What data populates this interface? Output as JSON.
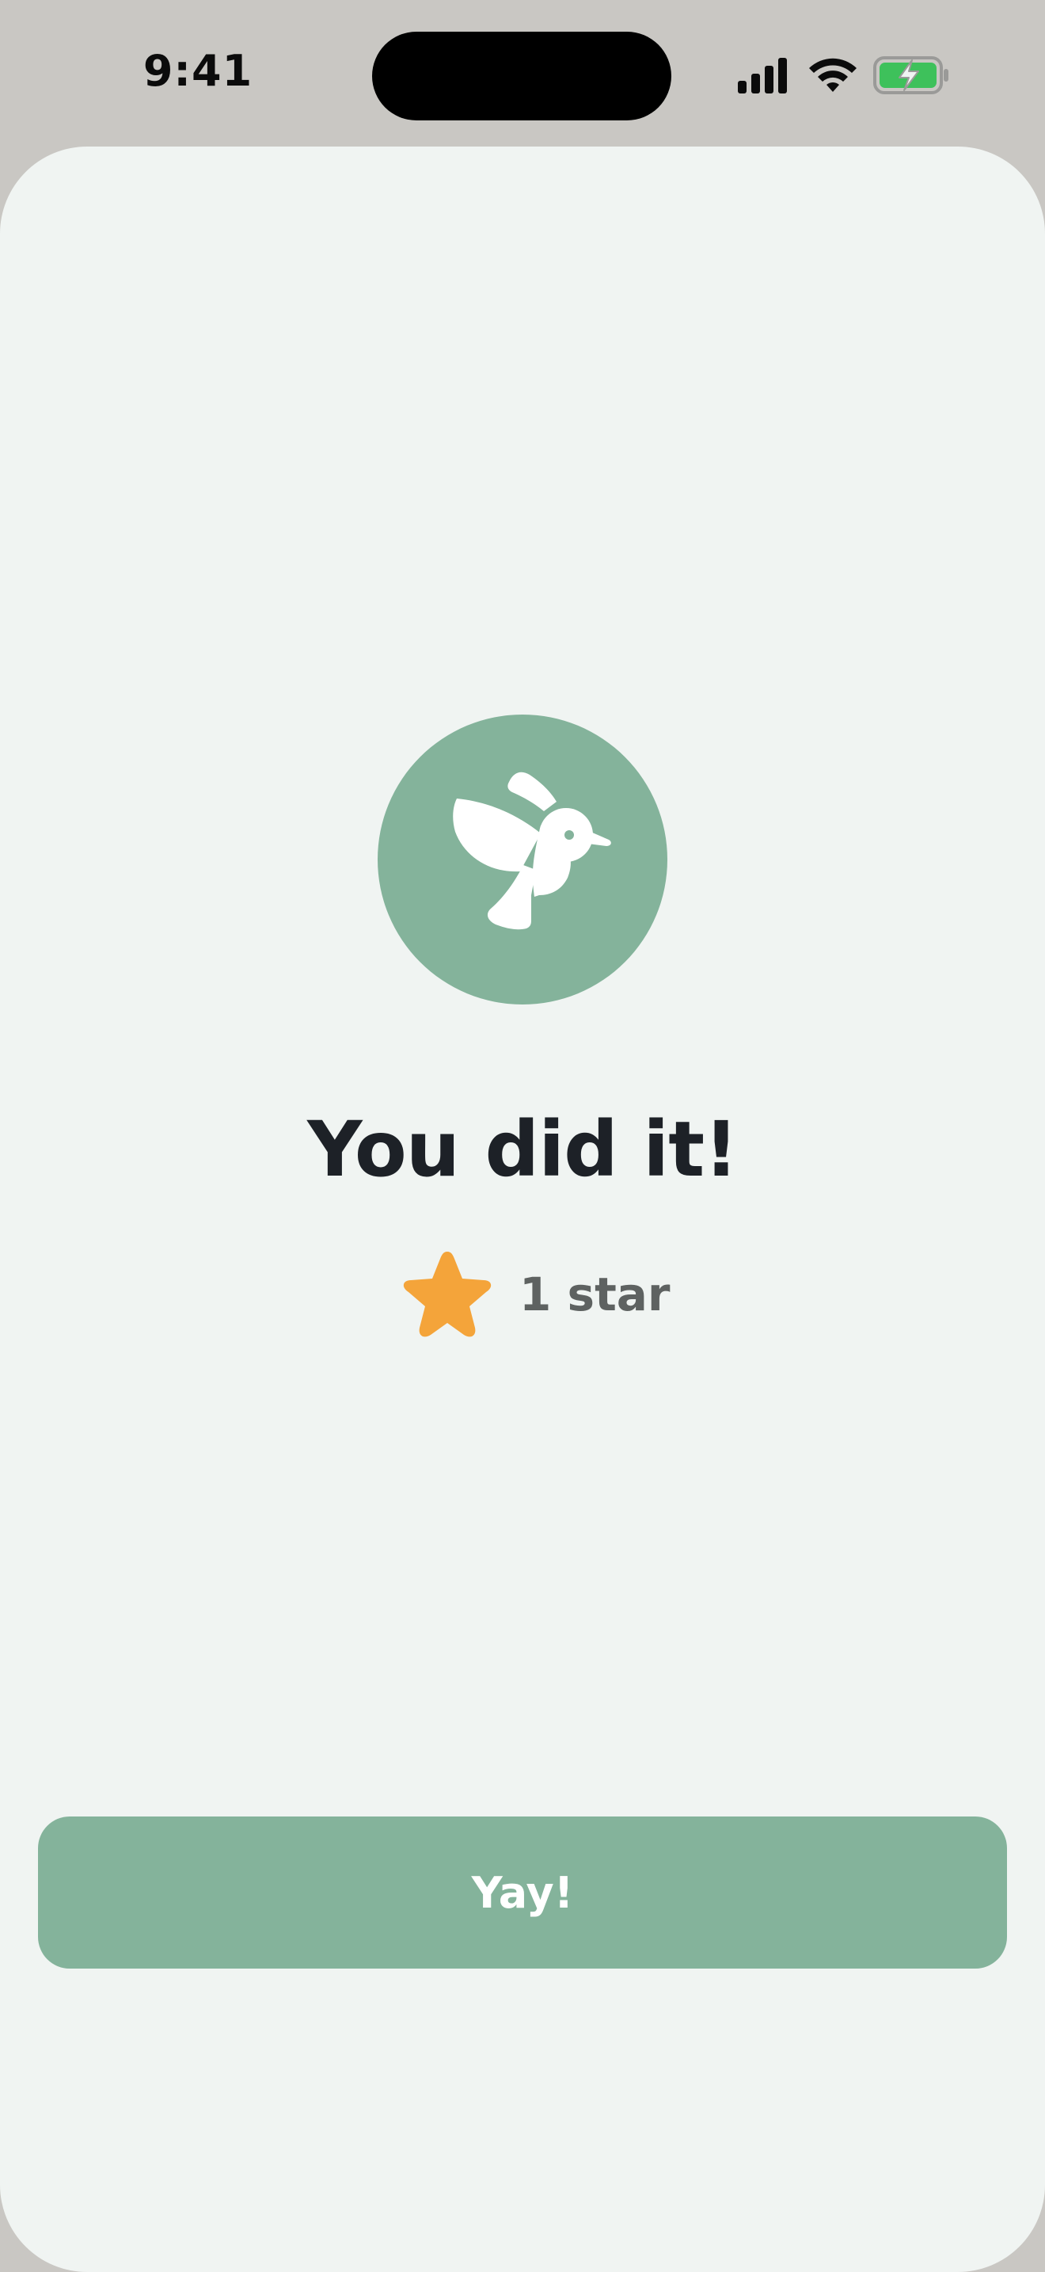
{
  "status_bar": {
    "time": "9:41",
    "icons": [
      "cellular-signal-icon",
      "wifi-icon",
      "battery-charging-icon"
    ]
  },
  "celebration": {
    "badge_icon": "hummingbird-icon",
    "title": "You did it!",
    "reward": {
      "icon": "star-icon",
      "label": "1 star"
    }
  },
  "actions": {
    "confirm_label": "Yay!"
  },
  "colors": {
    "accent_green": "#84b39b",
    "star": "#f4a43a",
    "background": "#f0f4f2",
    "title_text": "#1d2127",
    "muted_text": "#5e6261"
  }
}
